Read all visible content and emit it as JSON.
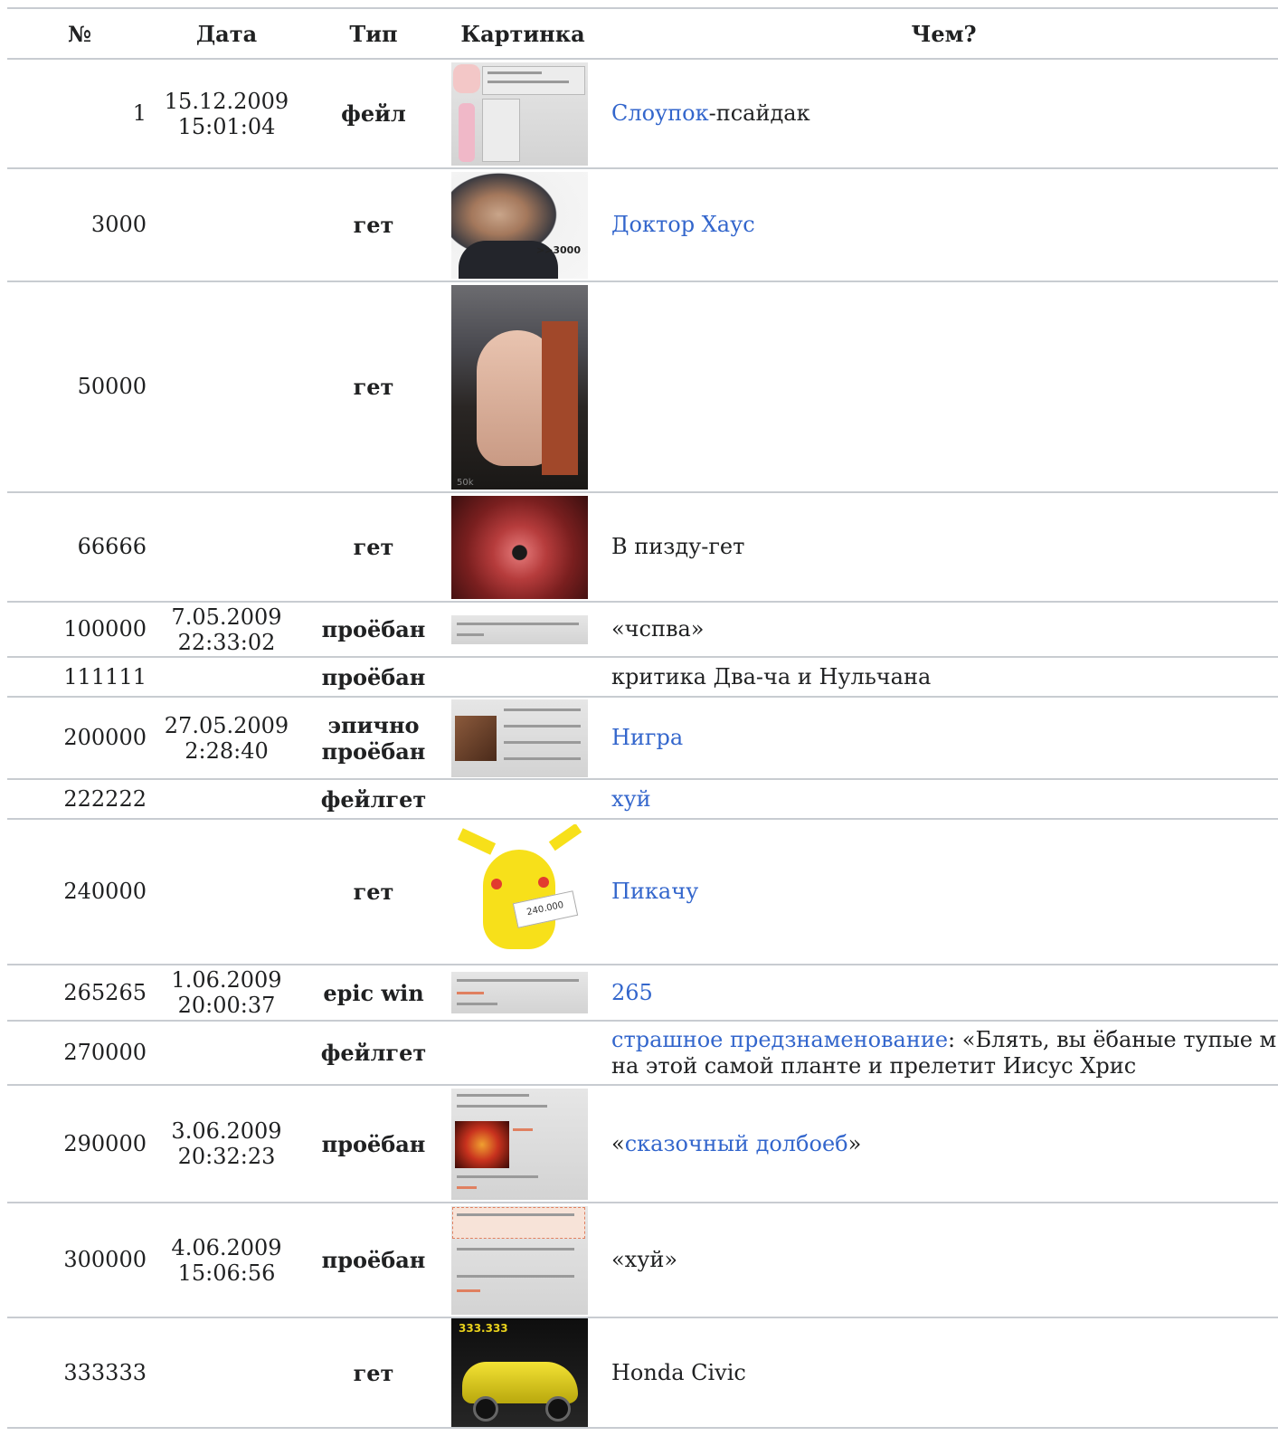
{
  "headers": {
    "num": "№",
    "date": "Дата",
    "type": "Тип",
    "picture": "Картинка",
    "what": "Чем?"
  },
  "rows": [
    {
      "num": "1",
      "date": "15.12.2009",
      "time": "15:01:04",
      "type": "фейл",
      "type2": "",
      "link": "Слоупок",
      "text": "-псайдак",
      "pre": "",
      "post": "",
      "picture": "doc-slowpoke"
    },
    {
      "num": "3000",
      "date": "",
      "time": "",
      "type": "гет",
      "type2": "",
      "link": "Доктор Хаус",
      "text": "",
      "pre": "",
      "post": "",
      "picture": "house-3000",
      "picture_caption": ">>3000"
    },
    {
      "num": "50000",
      "date": "",
      "time": "",
      "type": "гет",
      "type2": "",
      "link": "",
      "text": "",
      "pre": "",
      "post": "",
      "picture": "girl-hat",
      "picture_caption": "50k"
    },
    {
      "num": "66666",
      "date": "",
      "time": "",
      "type": "гет",
      "type2": "",
      "link": "",
      "text": "В пизду-гет",
      "pre": "",
      "post": "",
      "picture": "photo-get"
    },
    {
      "num": "100000",
      "date": "7.05.2009",
      "time": "22:33:02",
      "type": "проёбан",
      "type2": "",
      "link": "",
      "text": "«чспва»",
      "pre": "",
      "post": "",
      "picture": "doc-100000"
    },
    {
      "num": "111111",
      "date": "",
      "time": "",
      "type": "проёбан",
      "type2": "",
      "link": "",
      "text": "критика Два-ча и Нульчана",
      "pre": "",
      "post": "",
      "picture": ""
    },
    {
      "num": "200000",
      "date": "27.05.2009",
      "time": "2:28:40",
      "type": "эпично",
      "type2": "проёбан",
      "link": "Нигра",
      "text": "",
      "pre": "",
      "post": "",
      "picture": "doc-200000"
    },
    {
      "num": "222222",
      "date": "",
      "time": "",
      "type": "фейлгет",
      "type2": "",
      "link": "хуй",
      "text": "",
      "pre": "",
      "post": "",
      "picture": ""
    },
    {
      "num": "240000",
      "date": "",
      "time": "",
      "type": "гет",
      "type2": "",
      "link": "Пикачу",
      "text": "",
      "pre": "",
      "post": "",
      "picture": "pikachu",
      "picture_caption": "240.000"
    },
    {
      "num": "265265",
      "date": "1.06.2009",
      "time": "20:00:37",
      "type": "epic win",
      "type2": "",
      "link": "265",
      "text": "",
      "pre": "",
      "post": "",
      "picture": "doc-265265"
    },
    {
      "num": "270000",
      "date": "",
      "time": "",
      "type": "фейлгет",
      "type2": "",
      "link": "страшное предзнаменование",
      "text": ": «Блять, вы ёбаные тупые м тп. Так вот, на этой самой планте и прелетит Иисус Хрис",
      "pre": "",
      "post": "",
      "picture": ""
    },
    {
      "num": "290000",
      "date": "3.06.2009",
      "time": "20:32:23",
      "type": "проёбан",
      "type2": "",
      "link": "сказочный долбоеб",
      "text": "",
      "pre": "«",
      "post": "»",
      "picture": "doc-290000"
    },
    {
      "num": "300000",
      "date": "4.06.2009",
      "time": "15:06:56",
      "type": "проёбан",
      "type2": "",
      "link": "",
      "text": "«хуй»",
      "pre": "",
      "post": "",
      "picture": "doc-300000"
    },
    {
      "num": "333333",
      "date": "",
      "time": "",
      "type": "гет",
      "type2": "",
      "link": "",
      "text": "Honda Civic",
      "pre": "",
      "post": "",
      "picture": "honda",
      "picture_caption": "333.333"
    }
  ]
}
